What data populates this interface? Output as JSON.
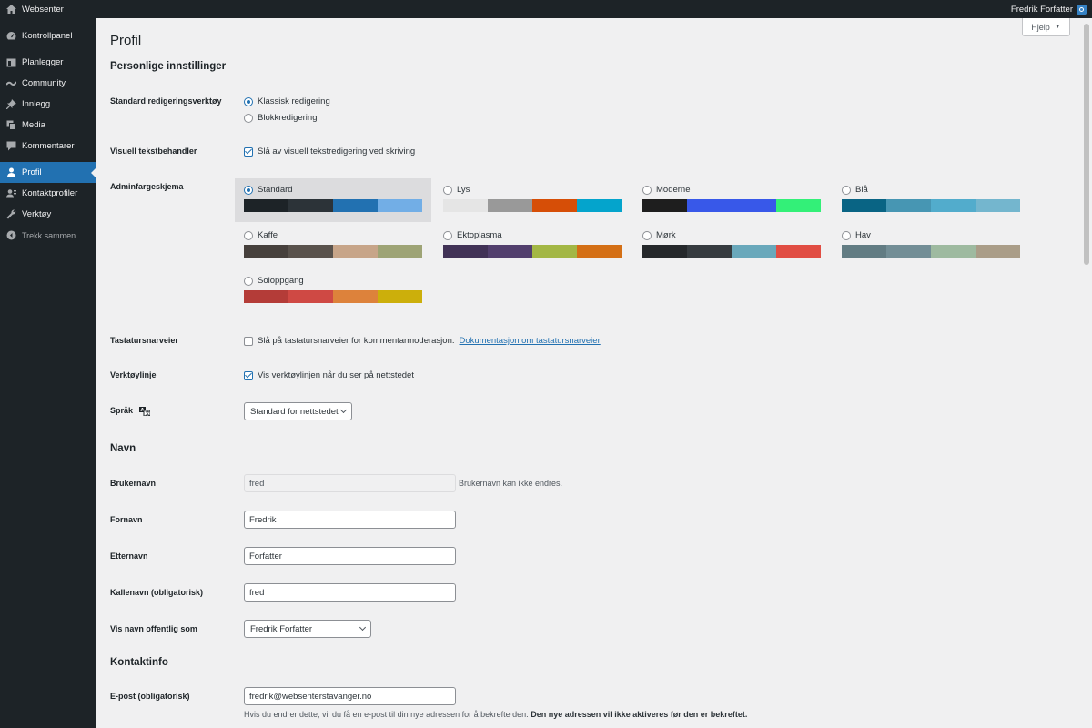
{
  "adminbar": {
    "site_name": "Websenter",
    "user_name": "Fredrik Forfatter"
  },
  "sidebar": {
    "items": [
      {
        "label": "Kontrollpanel",
        "icon": "dashboard-icon"
      },
      {
        "label": "Planlegger",
        "icon": "calendar-icon"
      },
      {
        "label": "Community",
        "icon": "community-icon"
      },
      {
        "label": "Innlegg",
        "icon": "pin-icon"
      },
      {
        "label": "Media",
        "icon": "media-icon"
      },
      {
        "label": "Kommentarer",
        "icon": "comment-icon"
      },
      {
        "label": "Profil",
        "icon": "user-icon",
        "current": true
      },
      {
        "label": "Kontaktprofiler",
        "icon": "contact-icon"
      },
      {
        "label": "Verktøy",
        "icon": "wrench-icon"
      },
      {
        "label": "Trekk sammen",
        "icon": "collapse-icon"
      }
    ]
  },
  "help": {
    "label": "Hjelp"
  },
  "page": {
    "title": "Profil"
  },
  "sections": {
    "personal": "Personlige innstillinger",
    "name": "Navn",
    "contact": "Kontaktinfo"
  },
  "editor": {
    "label": "Standard redigeringsverktøy",
    "options": [
      "Klassisk redigering",
      "Blokkredigering"
    ],
    "selected": "Klassisk redigering"
  },
  "visual_editor": {
    "label": "Visuell tekstbehandler",
    "checkbox": "Slå av visuell tekstredigering ved skriving",
    "checked": true
  },
  "color_scheme": {
    "label": "Adminfargeskjema",
    "selected": "Standard",
    "schemes": [
      {
        "name": "Standard",
        "colors": [
          "#1d2327",
          "#2c3338",
          "#2271b1",
          "#72aee6"
        ]
      },
      {
        "name": "Lys",
        "colors": [
          "#e5e5e5",
          "#999999",
          "#d64e07",
          "#04a4cc"
        ]
      },
      {
        "name": "Moderne",
        "colors": [
          "#1e1e1e",
          "#3858e9",
          "#3858e9",
          "#33f078"
        ]
      },
      {
        "name": "Blå",
        "colors": [
          "#096484",
          "#4796b3",
          "#52accc",
          "#74b6ce"
        ]
      },
      {
        "name": "Kaffe",
        "colors": [
          "#46403c",
          "#59524c",
          "#c7a589",
          "#9ea476"
        ]
      },
      {
        "name": "Ektoplasma",
        "colors": [
          "#413256",
          "#523f6d",
          "#a3b745",
          "#d46f15"
        ]
      },
      {
        "name": "Mørk",
        "colors": [
          "#25282b",
          "#363b3f",
          "#69a8bb",
          "#e14d43"
        ]
      },
      {
        "name": "Hav",
        "colors": [
          "#627c83",
          "#738e96",
          "#9ebaa0",
          "#aa9d88"
        ]
      },
      {
        "name": "Soloppgang",
        "colors": [
          "#b43c38",
          "#cf4944",
          "#dd823b",
          "#ccaf0b"
        ]
      }
    ]
  },
  "shortcuts": {
    "label": "Tastatursnarveier",
    "checkbox": "Slå på tastatursnarveier for kommentarmoderasjon.",
    "link": "Dokumentasjon om tastatursnarveier",
    "checked": false
  },
  "toolbar": {
    "label": "Verktøylinje",
    "checkbox": "Vis verktøylinjen når du ser på nettstedet",
    "checked": true
  },
  "language": {
    "label": "Språk",
    "value": "Standard for nettstedet"
  },
  "username": {
    "label": "Brukernavn",
    "value": "fred",
    "note": "Brukernavn kan ikke endres."
  },
  "first_name": {
    "label": "Fornavn",
    "value": "Fredrik"
  },
  "last_name": {
    "label": "Etternavn",
    "value": "Forfatter"
  },
  "nickname": {
    "label": "Kallenavn (obligatorisk)",
    "value": "fred"
  },
  "display_name": {
    "label": "Vis navn offentlig som",
    "value": "Fredrik Forfatter"
  },
  "email": {
    "label": "E-post (obligatorisk)",
    "value": "fredrik@websenterstavanger.no",
    "note": "Hvis du endrer dette, vil du få en e-post til din nye adressen for å bekrefte den.",
    "note_bold": "Den nye adressen vil ikke aktiveres før den er bekreftet."
  }
}
